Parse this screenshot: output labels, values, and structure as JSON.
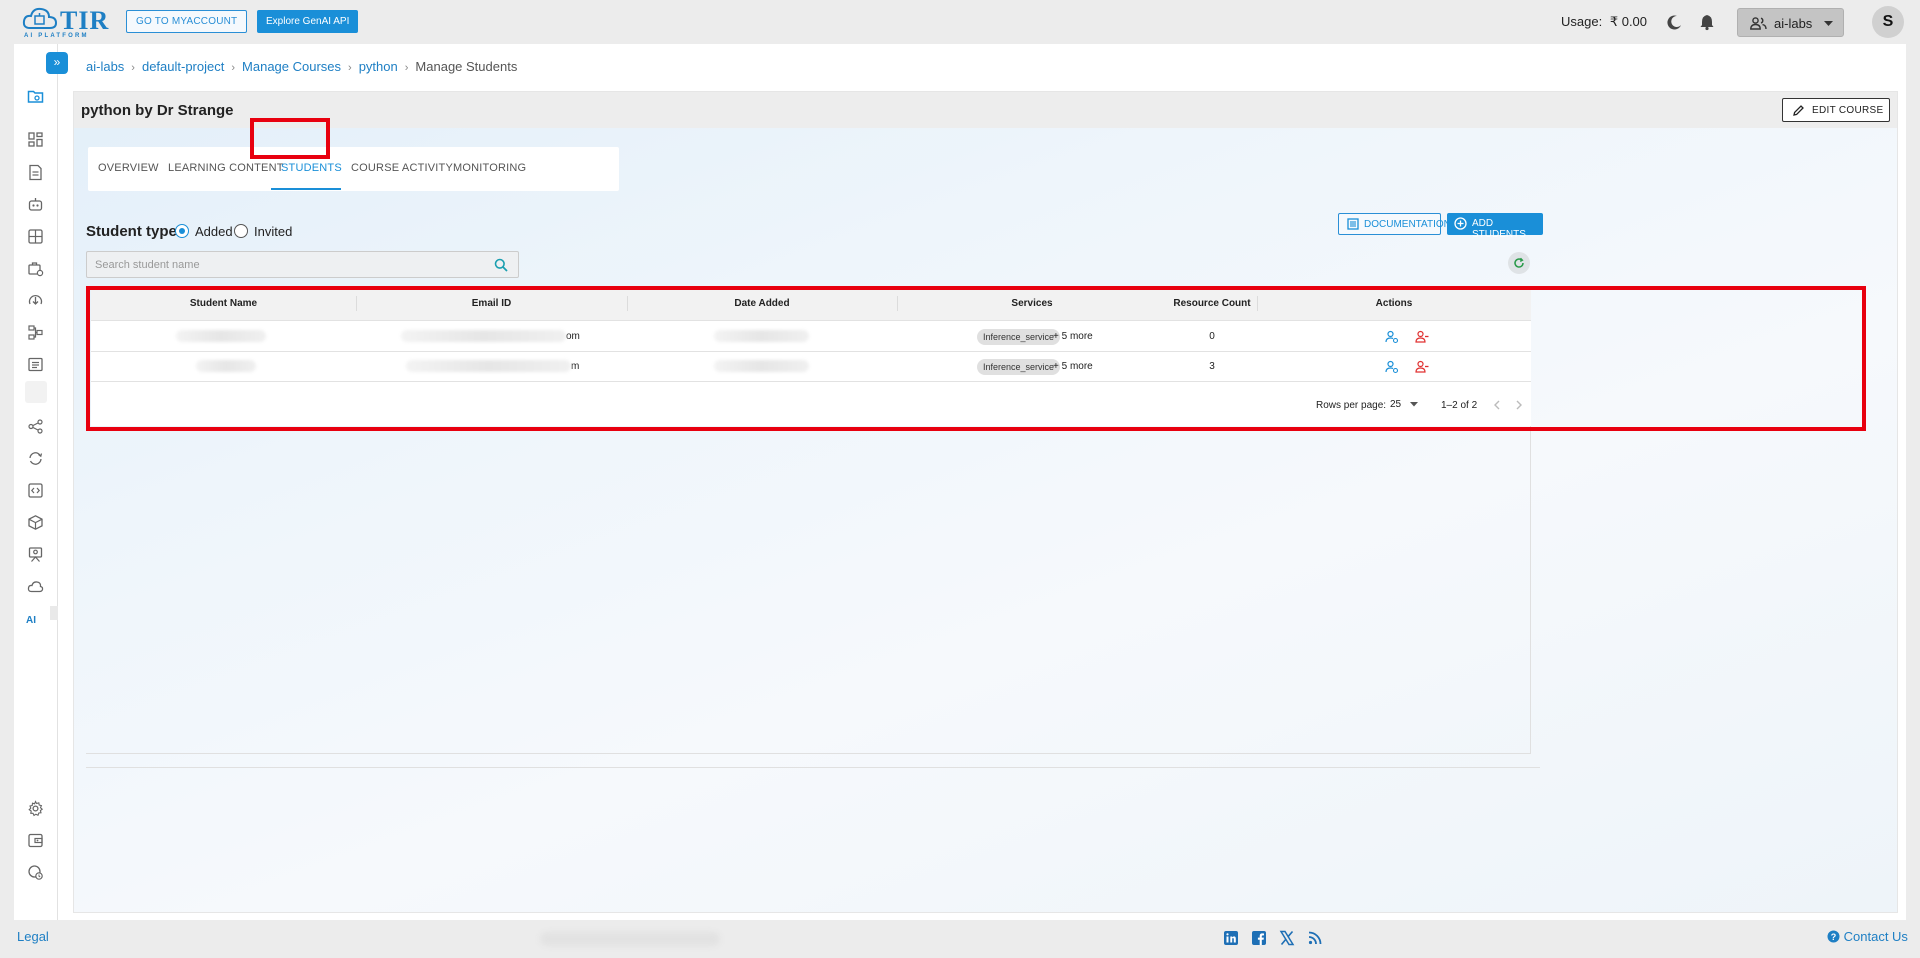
{
  "header": {
    "logo_text": "TIR",
    "logo_sub": "AI PLATFORM",
    "myaccount_label": "GO TO MYACCOUNT",
    "genai_label": "Explore GenAI API",
    "usage_label": "Usage:",
    "usage_value": "₹ 0.00",
    "team_label": "ai-labs",
    "avatar_initial": "S"
  },
  "breadcrumb": {
    "items": [
      "ai-labs",
      "default-project",
      "Manage Courses",
      "python"
    ],
    "current": "Manage Students"
  },
  "course": {
    "title": "python by Dr Strange",
    "edit_label": "EDIT COURSE"
  },
  "tabs": [
    "OVERVIEW",
    "LEARNING CONTENT",
    "STUDENTS",
    "COURSE ACTIVITY",
    "MONITORING"
  ],
  "active_tab": "STUDENTS",
  "student_type": {
    "label": "Student type:",
    "options": [
      "Added",
      "Invited"
    ],
    "selected": "Added"
  },
  "actions": {
    "documentation_label": "DOCUMENTATION",
    "add_students_label": "ADD STUDENTS"
  },
  "search": {
    "placeholder": "Search student name",
    "value": ""
  },
  "table": {
    "columns": [
      "Student Name",
      "Email ID",
      "Date Added",
      "Services",
      "Resource Count",
      "Actions"
    ],
    "rows": [
      {
        "email_suffix": "om",
        "service": "Inference_service",
        "more": "+ 5 more",
        "resource_count": "0"
      },
      {
        "email_suffix": "m",
        "service": "Inference_service",
        "more": "+ 5 more",
        "resource_count": "3"
      }
    ],
    "pagination": {
      "rows_per_page_label": "Rows per page:",
      "rows_per_page": "25",
      "range": "1–2 of 2"
    }
  },
  "sidebar": {
    "ai_mark": "AI"
  },
  "footer": {
    "legal": "Legal",
    "contact": "Contact Us",
    "social": [
      "linkedin-icon",
      "facebook-icon",
      "x-icon",
      "rss-icon"
    ]
  },
  "colors": {
    "accent": "#1a8fd8",
    "highlight": "#e8000f",
    "brand": "#1e7fc4"
  }
}
